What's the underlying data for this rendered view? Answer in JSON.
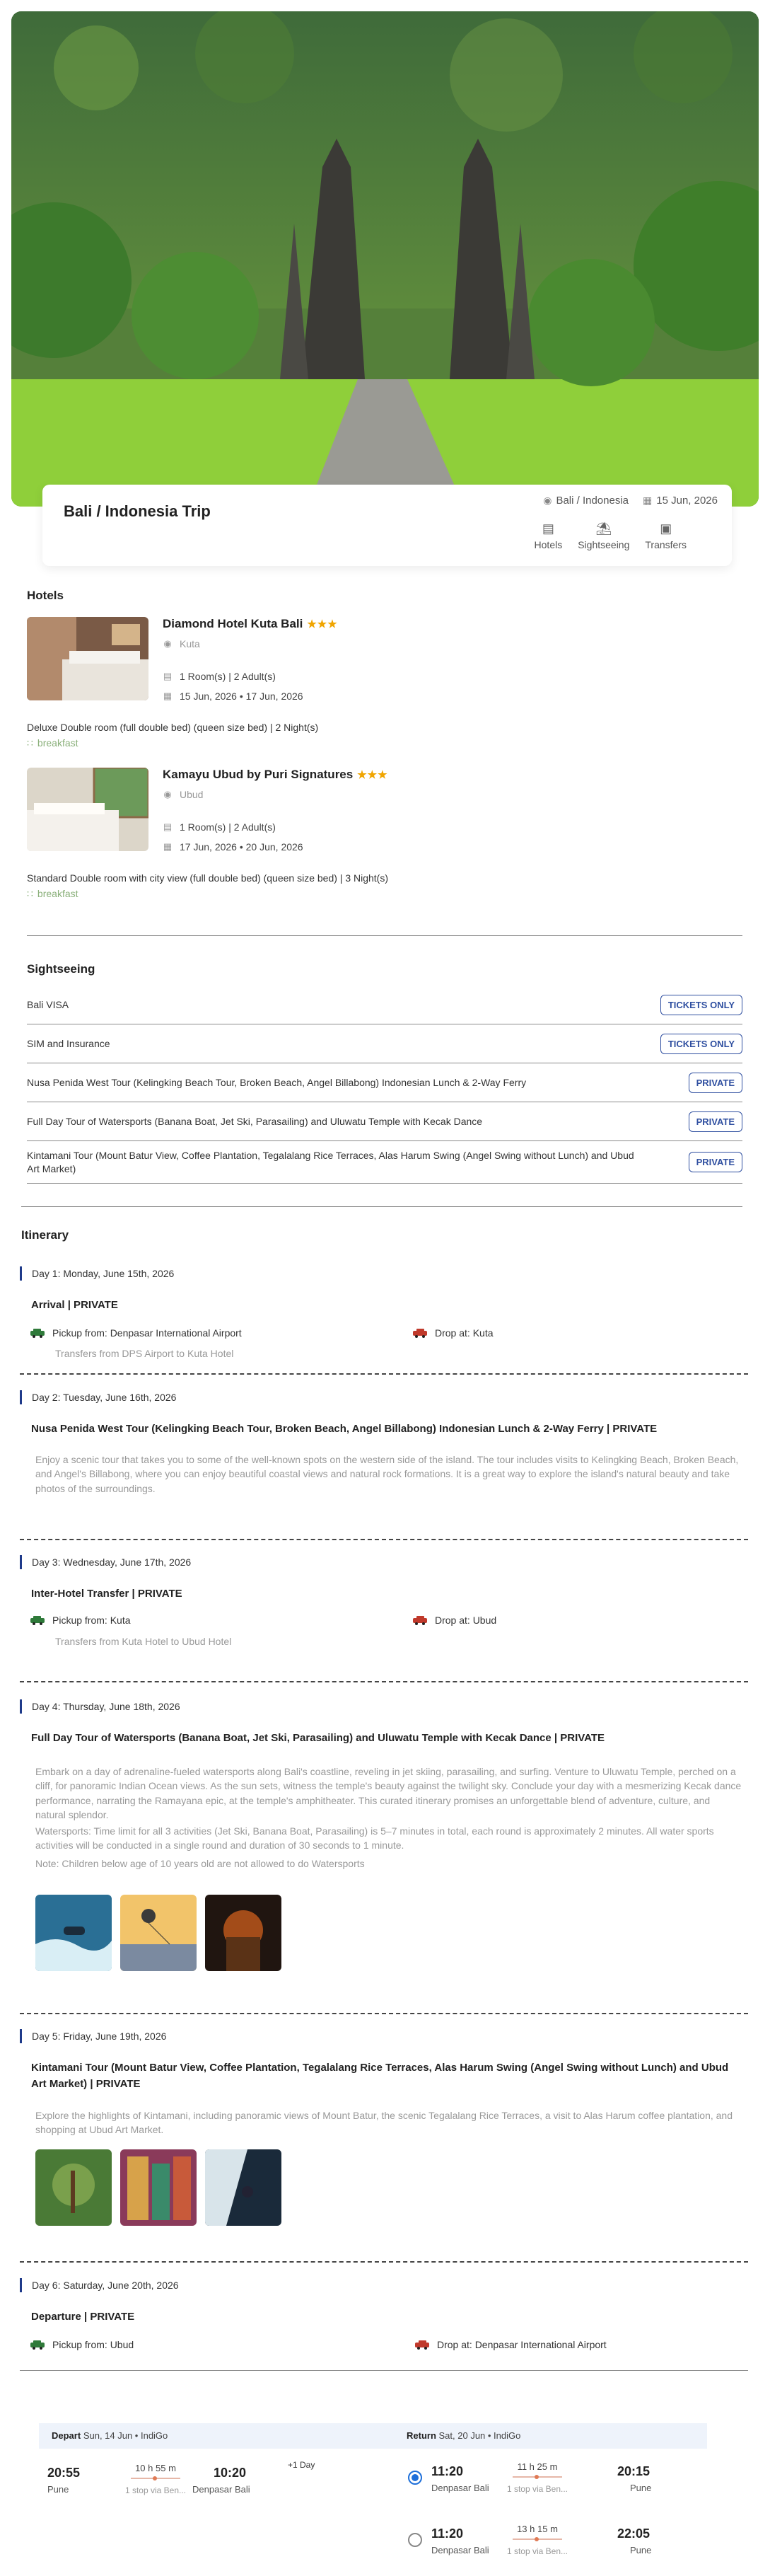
{
  "trip": {
    "title": "Bali / Indonesia Trip",
    "location": "Bali / Indonesia",
    "date": "15 Jun, 2026",
    "tabs": [
      "Hotels",
      "Sightseeing",
      "Transfers"
    ]
  },
  "hotels": {
    "heading": "Hotels",
    "items": [
      {
        "name": "Diamond Hotel Kuta Bali",
        "stars": "★★★",
        "location": "Kuta",
        "rooms": "1 Room(s) | 2 Adult(s)",
        "dates": "15 Jun, 2026 • 17 Jun, 2026",
        "room_desc": "Deluxe Double room (full double bed) (queen size bed) | 2 Night(s)",
        "meal": "breakfast"
      },
      {
        "name": "Kamayu Ubud by Puri Signatures",
        "stars": "★★★",
        "location": "Ubud",
        "rooms": "1 Room(s) | 2 Adult(s)",
        "dates": "17 Jun, 2026 • 20 Jun, 2026",
        "room_desc": "Standard Double room with city view (full double bed) (queen size bed) | 3 Night(s)",
        "meal": "breakfast"
      }
    ]
  },
  "sightseeing": {
    "heading": "Sightseeing",
    "items": [
      {
        "label": "Bali VISA",
        "badge": "TICKETS ONLY"
      },
      {
        "label": "SIM and Insurance",
        "badge": "TICKETS ONLY"
      },
      {
        "label": "Nusa Penida West Tour (Kelingking Beach Tour, Broken Beach, Angel Billabong) Indonesian Lunch & 2-Way Ferry",
        "badge": "PRIVATE"
      },
      {
        "label": "Full Day Tour of Watersports (Banana Boat, Jet Ski, Parasailing) and Uluwatu Temple with Kecak Dance",
        "badge": "PRIVATE"
      },
      {
        "label": "Kintamani Tour (Mount Batur View, Coffee Plantation, Tegalalang Rice Terraces, Alas Harum Swing (Angel Swing without Lunch) and Ubud Art Market)",
        "badge": "PRIVATE"
      }
    ]
  },
  "itinerary": {
    "heading": "Itinerary",
    "days": [
      {
        "label": "Day 1: Monday, June 15th, 2026",
        "title": "Arrival | PRIVATE",
        "pickup": "Pickup from: Denpasar International Airport",
        "drop": "Drop at: Kuta",
        "sub": "Transfers from DPS Airport to Kuta Hotel"
      },
      {
        "label": "Day 2: Tuesday, June 16th, 2026",
        "title": "Nusa Penida West Tour (Kelingking Beach Tour, Broken Beach, Angel Billabong) Indonesian Lunch & 2-Way Ferry | PRIVATE",
        "desc": "Enjoy a scenic tour that takes you to some of the well-known spots on the western side of the island. The tour includes visits to Kelingking Beach, Broken Beach, and Angel's Billabong, where you can enjoy beautiful coastal views and natural rock formations. It is a great way to explore the island's natural beauty and take photos of the surroundings."
      },
      {
        "label": "Day 3: Wednesday, June 17th, 2026",
        "title": "Inter-Hotel Transfer | PRIVATE",
        "pickup": "Pickup from: Kuta",
        "drop": "Drop at: Ubud",
        "sub": "Transfers from Kuta Hotel to Ubud Hotel"
      },
      {
        "label": "Day 4: Thursday, June 18th, 2026",
        "title": "Full Day Tour of Watersports (Banana Boat, Jet Ski, Parasailing) and Uluwatu Temple with Kecak Dance | PRIVATE",
        "desc": "Embark on a day of adrenaline-fueled watersports along Bali's coastline, reveling in jet skiing, parasailing, and surfing. Venture to Uluwatu Temple, perched on a cliff, for panoramic Indian Ocean views. As the sun sets, witness the temple's beauty against the twilight sky. Conclude your day with a mesmerizing Kecak dance performance, narrating the Ramayana epic, at the temple's amphitheater. This curated itinerary promises an unforgettable blend of adventure, culture, and natural splendor.",
        "desc2": "Watersports: Time limit for all 3 activities (Jet Ski, Banana Boat, Parasailing) is 5–7 minutes in total, each round is approximately 2 minutes. All water sports activities will be conducted in a single round and duration of 30 seconds to 1 minute.",
        "desc3": "Note: Children below age of 10 years old are not allowed to do Watersports"
      },
      {
        "label": "Day 5: Friday, June 19th, 2026",
        "title": "Kintamani Tour (Mount Batur View, Coffee Plantation, Tegalalang Rice Terraces, Alas Harum Swing (Angel Swing without Lunch) and Ubud Art Market) | PRIVATE",
        "desc": "Explore the highlights of Kintamani, including panoramic views of Mount Batur, the scenic Tegalalang Rice Terraces, a visit to Alas Harum coffee plantation, and shopping at Ubud Art Market."
      },
      {
        "label": "Day 6: Saturday, June 20th, 2026",
        "title": "Departure | PRIVATE",
        "pickup": "Pickup from: Ubud",
        "drop": "Drop at: Denpasar International Airport"
      }
    ]
  },
  "flights": {
    "depart": {
      "head_bold": "Depart",
      "head_rest": "Sun, 14 Jun • IndiGo",
      "dep_time": "20:55",
      "dep_city": "Pune",
      "duration": "10 h 55 m",
      "stops": "1 stop via Ben...",
      "arr_time": "10:20",
      "arr_city": "Denpasar Bali",
      "plus_day": "+1 Day"
    },
    "return": {
      "head_bold": "Return",
      "head_rest": "Sat, 20 Jun • IndiGo",
      "options": [
        {
          "dep_time": "11:20",
          "dep_city": "Denpasar Bali",
          "duration": "11 h 25 m",
          "stops": "1 stop via Ben...",
          "arr_time": "20:15",
          "arr_city": "Pune"
        },
        {
          "dep_time": "11:20",
          "dep_city": "Denpasar Bali",
          "duration": "13 h 15 m",
          "stops": "1 stop via Ben...",
          "arr_time": "22:05",
          "arr_city": "Pune"
        }
      ]
    }
  }
}
